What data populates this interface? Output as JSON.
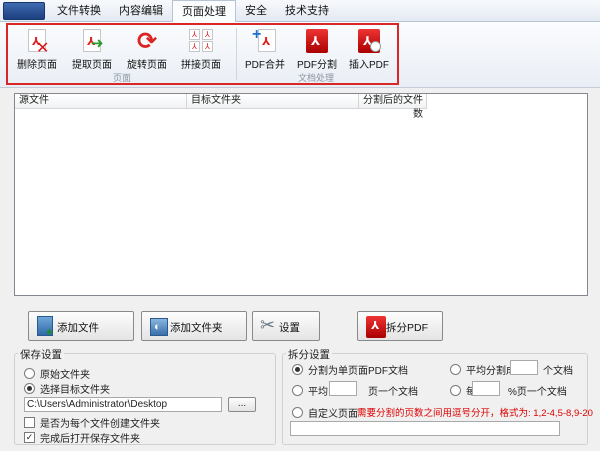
{
  "menu": {
    "tabs": [
      {
        "label": "文件转换",
        "active": false
      },
      {
        "label": "内容编辑",
        "active": false
      },
      {
        "label": "页面处理",
        "active": true
      },
      {
        "label": "安全",
        "active": false
      },
      {
        "label": "技术支持",
        "active": false
      }
    ]
  },
  "ribbon": {
    "page_group": {
      "label": "页面",
      "buttons": [
        {
          "label": "删除页面",
          "icon": "delete-page-icon"
        },
        {
          "label": "提取页面",
          "icon": "extract-page-icon"
        },
        {
          "label": "旋转页面",
          "icon": "rotate-page-icon"
        },
        {
          "label": "拼接页面",
          "icon": "join-page-icon"
        }
      ]
    },
    "doc_group": {
      "label": "文档处理",
      "buttons": [
        {
          "label": "PDF合并",
          "icon": "pdf-merge-icon"
        },
        {
          "label": "PDF分割",
          "icon": "pdf-split-icon"
        },
        {
          "label": "插入PDF",
          "icon": "insert-pdf-icon"
        }
      ]
    },
    "highlight_color": "#d92727"
  },
  "list": {
    "columns": [
      "源文件",
      "目标文件夹",
      "分割后的文件数"
    ],
    "rows": []
  },
  "actions": {
    "add_file": "添加文件",
    "add_folder": "添加文件夹",
    "settings": "设置",
    "split_pdf": "拆分PDF"
  },
  "save_settings": {
    "title": "保存设置",
    "option_original": "原始文件夹",
    "option_target": "选择目标文件夹",
    "selected": "target",
    "path": "C:\\Users\\Administrator\\Desktop",
    "browse_label": "...",
    "create_folder_each": {
      "label": "是否为每个文件创建文件夹",
      "checked": false
    },
    "open_after": {
      "label": "完成后打开保存文件夹",
      "checked": true
    }
  },
  "split_settings": {
    "title": "拆分设置",
    "opt_single": "分割为单页面PDF文档",
    "opt_even": "平均分割成",
    "opt_even_suffix": "个文档",
    "opt_avg": "平均",
    "opt_avg_suffix": "页一个文档",
    "opt_every": "每",
    "opt_every_suffix": "%页一个文档",
    "opt_custom": "自定义页面",
    "custom_hint": "需要分割的页数之间用逗号分开，格式为: 1,2-4,5-8,9-20",
    "selected": "single",
    "hint_color": "#d00000"
  }
}
